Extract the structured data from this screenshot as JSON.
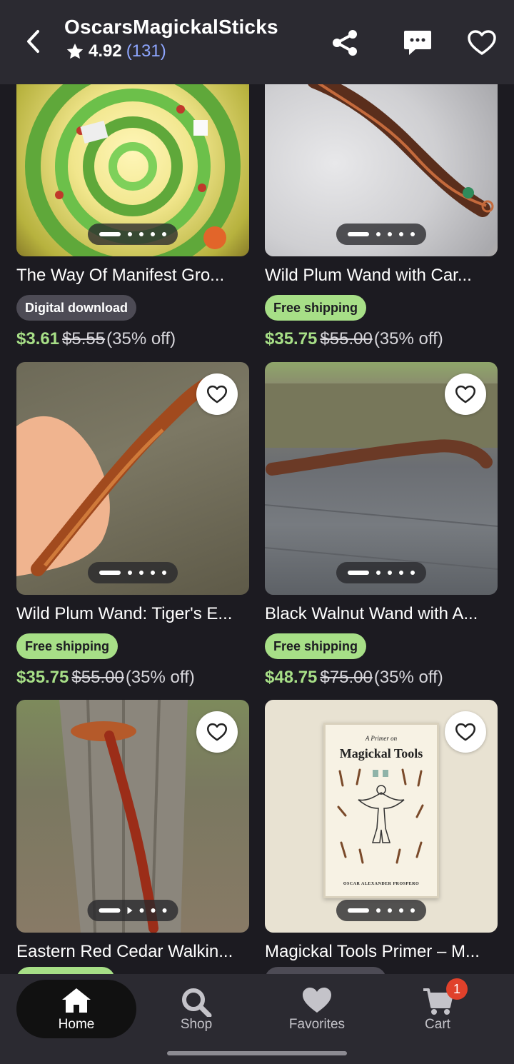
{
  "header": {
    "shop_name": "OscarsMagickalSticks",
    "rating": "4.92",
    "review_count": "(131)"
  },
  "listings": [
    {
      "title": "The Way Of Manifest Gro...",
      "badge": "Digital download",
      "badge_type": "gray",
      "price": "$3.61",
      "original_price": "$5.55",
      "discount": "(35% off)"
    },
    {
      "title": "Wild Plum Wand with Car...",
      "badge": "Free shipping",
      "badge_type": "green",
      "price": "$35.75",
      "original_price": "$55.00",
      "discount": "(35% off)"
    },
    {
      "title": "Wild Plum Wand: Tiger's E...",
      "badge": "Free shipping",
      "badge_type": "green",
      "price": "$35.75",
      "original_price": "$55.00",
      "discount": "(35% off)"
    },
    {
      "title": "Black Walnut Wand with A...",
      "badge": "Free shipping",
      "badge_type": "green",
      "price": "$48.75",
      "original_price": "$75.00",
      "discount": "(35% off)"
    },
    {
      "title": "Eastern Red Cedar Walkin...",
      "badge": "",
      "badge_type": "green",
      "price": "",
      "original_price": "",
      "discount": ""
    },
    {
      "title": "Magickal Tools Primer – M...",
      "badge": "",
      "badge_type": "gray",
      "price": "",
      "original_price": "",
      "discount": ""
    }
  ],
  "book": {
    "subtitle": "A Primer on",
    "title": "Magickal Tools",
    "author": "OSCAR ALEXANDER PROSPERO"
  },
  "nav": {
    "home": "Home",
    "shop": "Shop",
    "favorites": "Favorites",
    "cart": "Cart",
    "cart_count": "1"
  },
  "colors": {
    "background": "#1c1b21",
    "header": "#2b2a31",
    "green_price": "#a7df87",
    "review_link": "#8ea6ff",
    "cart_badge": "#e0412b"
  }
}
